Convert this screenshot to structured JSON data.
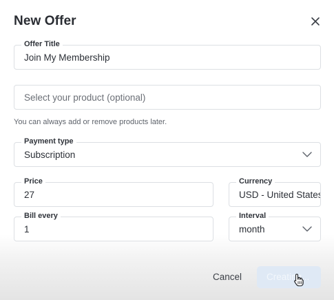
{
  "dialog": {
    "title": "New Offer"
  },
  "offer_title": {
    "label": "Offer Title",
    "value": "Join My Membership"
  },
  "product": {
    "placeholder": "Select your product (optional)",
    "helper": "You can always add or remove products later."
  },
  "payment_type": {
    "label": "Payment type",
    "value": "Subscription"
  },
  "price": {
    "label": "Price",
    "value": "27"
  },
  "currency": {
    "label": "Currency",
    "value": "USD - United States Dollar"
  },
  "bill_every": {
    "label": "Bill every",
    "value": "1"
  },
  "interval": {
    "label": "Interval",
    "value": "month"
  },
  "actions": {
    "cancel_label": "Cancel",
    "create_label": "Creating..."
  },
  "colors": {
    "primary_disabled_bg": "#dfe9f5",
    "border": "#dcdfe3"
  }
}
